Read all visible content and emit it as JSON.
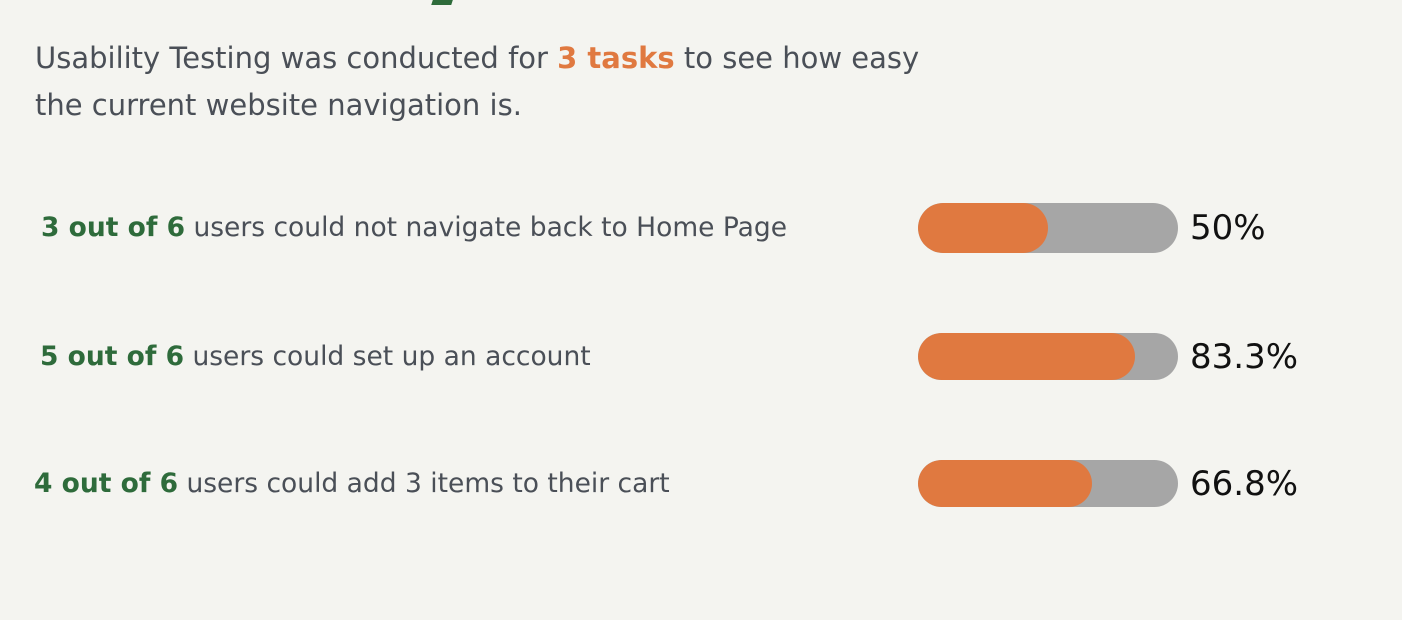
{
  "intro": {
    "before": "Usability Testing was conducted for ",
    "highlight": "3 tasks",
    "after": " to see how easy the current website navigation is."
  },
  "results": [
    {
      "count": "3 out of 6",
      "description": " users could not navigate back to Home Page",
      "percent_label": "50%",
      "fill_percent": 50
    },
    {
      "count": "5 out of 6",
      "description": " users could set up an account",
      "percent_label": "83.3%",
      "fill_percent": 83.3
    },
    {
      "count": "4 out of 6",
      "description": " users could add 3 items to their cart",
      "percent_label": "66.8%",
      "fill_percent": 66.8
    }
  ],
  "colors": {
    "accent_orange": "#e07940",
    "accent_green": "#2e6b3b",
    "bar_track": "#a6a6a6",
    "background": "#f4f4f0",
    "body_text": "#4a4f57"
  }
}
